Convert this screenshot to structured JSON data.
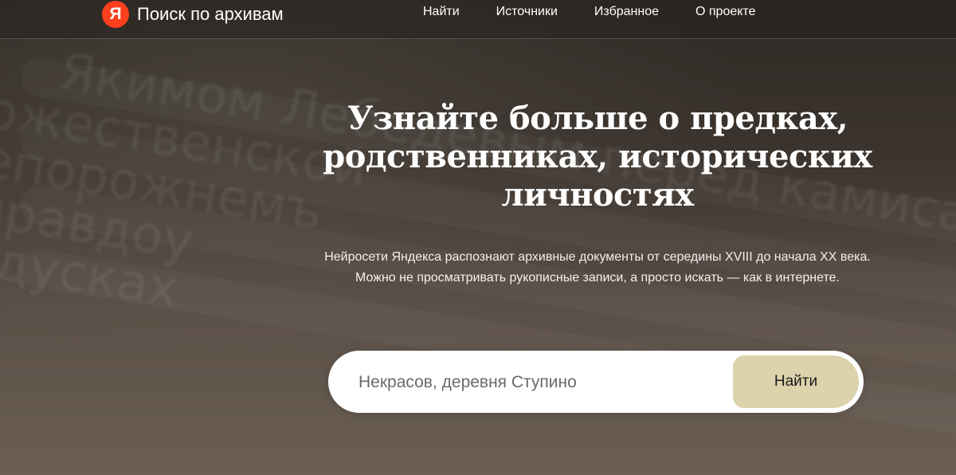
{
  "header": {
    "logo_letter": "Я",
    "title": "Поиск по архивам",
    "nav": [
      "Найти",
      "Источники",
      "Избранное",
      "О проекте"
    ]
  },
  "hero": {
    "title_lines": [
      "Узнайте больше о предках,",
      "родственниках, исторических",
      "личностях"
    ],
    "subtitle_lines": [
      "Нейросети Яндекса распознают архивные документы от середины XVIII до начала XX века.",
      "Можно не просматривать рукописные записи, а просто искать — как в интернете."
    ]
  },
  "search": {
    "placeholder": "Некрасов, деревня Ступино",
    "button_label": "Найти"
  },
  "colors": {
    "brand": "#fc3f1d",
    "button_bg": "#dcd2ab"
  }
}
